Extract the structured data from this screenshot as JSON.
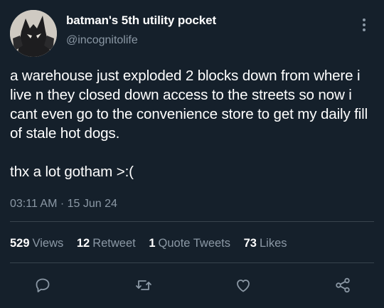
{
  "author": {
    "display_name": "batman's 5th utility pocket",
    "handle": "@incognitolife"
  },
  "tweet": {
    "body": "a warehouse just exploded 2 blocks down from where i live n they closed down access to the streets so now i cant even go to the convenience store to get my daily fill of stale hot dogs.\n\nthx a lot gotham >:(",
    "timestamp": "03:11 AM · 15 Jun 24"
  },
  "stats": [
    {
      "count": "529",
      "label": "Views"
    },
    {
      "count": "12",
      "label": "Retweet"
    },
    {
      "count": "1",
      "label": "Quote Tweets"
    },
    {
      "count": "73",
      "label": "Likes"
    }
  ],
  "actions": [
    "reply-icon",
    "retweet-icon",
    "like-icon",
    "share-icon"
  ],
  "colors": {
    "background": "#15202b",
    "secondary_text": "#8b98a5",
    "divider": "#38444d"
  }
}
